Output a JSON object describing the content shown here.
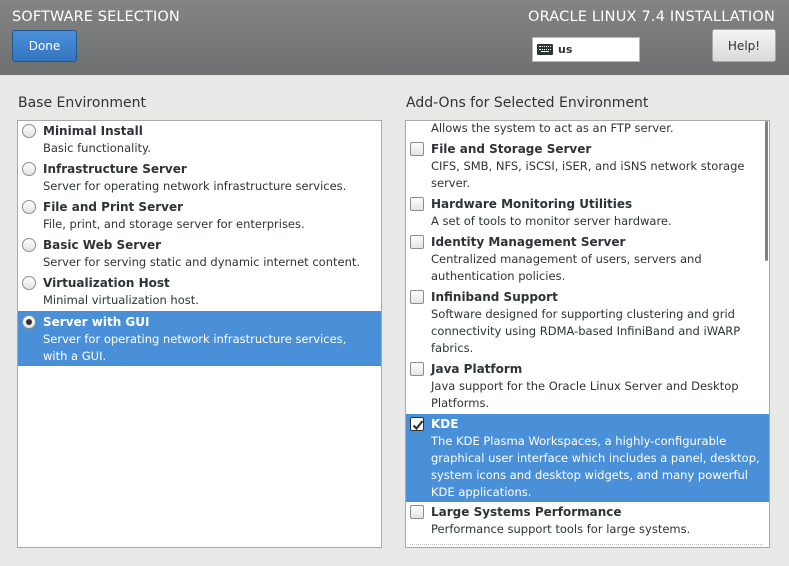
{
  "header": {
    "title": "SOFTWARE SELECTION",
    "product": "ORACLE LINUX 7.4 INSTALLATION",
    "done_label": "Done",
    "keyboard_layout": "us",
    "help_label": "Help!"
  },
  "base_environment": {
    "heading": "Base Environment",
    "items": [
      {
        "name": "Minimal Install",
        "description": "Basic functionality.",
        "selected": false
      },
      {
        "name": "Infrastructure Server",
        "description": "Server for operating network infrastructure services.",
        "selected": false
      },
      {
        "name": "File and Print Server",
        "description": "File, print, and storage server for enterprises.",
        "selected": false
      },
      {
        "name": "Basic Web Server",
        "description": "Server for serving static and dynamic internet content.",
        "selected": false
      },
      {
        "name": "Virtualization Host",
        "description": "Minimal virtualization host.",
        "selected": false
      },
      {
        "name": "Server with GUI",
        "description": "Server for operating network infrastructure services, with a GUI.",
        "selected": true
      }
    ]
  },
  "addons": {
    "heading": "Add-Ons for Selected Environment",
    "partial_top_text": "Allows the system to act as an FTP server.",
    "items": [
      {
        "name": "File and Storage Server",
        "description": "CIFS, SMB, NFS, iSCSI, iSER, and iSNS network storage server.",
        "checked": false
      },
      {
        "name": "Hardware Monitoring Utilities",
        "description": "A set of tools to monitor server hardware.",
        "checked": false
      },
      {
        "name": "Identity Management Server",
        "description": "Centralized management of users, servers and authentication policies.",
        "checked": false
      },
      {
        "name": "Infiniband Support",
        "description": "Software designed for supporting clustering and grid connectivity using RDMA-based InfiniBand and iWARP fabrics.",
        "checked": false
      },
      {
        "name": "Java Platform",
        "description": "Java support for the Oracle Linux Server and Desktop Platforms.",
        "checked": false
      },
      {
        "name": "KDE",
        "description": "The KDE Plasma Workspaces, a highly-configurable graphical user interface which includes a panel, desktop, system icons and desktop widgets, and many powerful KDE applications.",
        "checked": true
      },
      {
        "name": "Large Systems Performance",
        "description": "Performance support tools for large systems.",
        "checked": false
      }
    ]
  }
}
